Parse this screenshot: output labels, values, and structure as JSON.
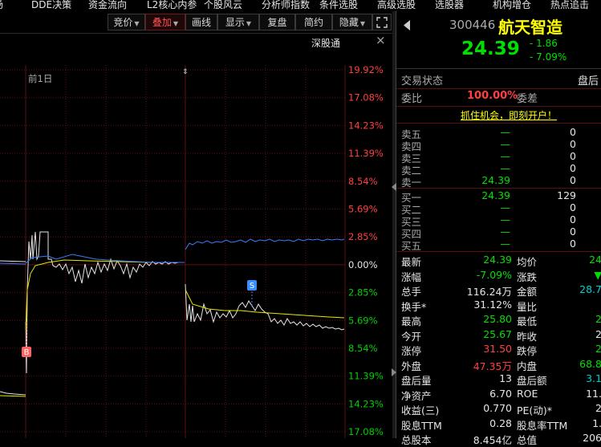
{
  "menu": [
    "场",
    "DDE决策",
    "资金流向",
    "L2核心内参",
    "个股风云",
    "分析师指数",
    "条件选股",
    "高级选股",
    "选股器",
    "机构增仓",
    "热点追击"
  ],
  "toolbar": {
    "buttons": [
      "竞价",
      "叠加",
      "画线",
      "显示",
      "复盘",
      "简约",
      "隐藏"
    ],
    "expand_icon": "expand-icon"
  },
  "chart": {
    "close_label": "×",
    "market_label": "深股通",
    "day_label": "前1日",
    "buy_marker": "B",
    "sell_marker": "S",
    "pct_labels": [
      "19.92%",
      "17.08%",
      "14.23%",
      "11.39%",
      "8.54%",
      "5.69%",
      "2.85%",
      "0.00%",
      "2.85%",
      "5.69%",
      "8.54%",
      "11.39%",
      "14.23%",
      "17.08%"
    ],
    "colors": {
      "up": "#ff3c3c",
      "down": "#00d000",
      "flat": "#e6e6e6",
      "avg": "#e8e800",
      "blue": "#3a7cff"
    }
  },
  "quote": {
    "code": "300446",
    "name": "航天智造",
    "price": "24.39",
    "change": "- 1.86",
    "change_pct": "- 7.09%",
    "trade_status_label": "交易状态",
    "trade_status_value": "盘后",
    "wei_bi_label": "委比",
    "wei_bi_value": "100.00%",
    "wei_cha_label": "委差",
    "promo": "抓住机会，即刻开户！"
  },
  "sell_book": [
    {
      "label": "卖五",
      "price": "—",
      "vol": "0"
    },
    {
      "label": "卖四",
      "price": "—",
      "vol": "0"
    },
    {
      "label": "卖三",
      "price": "—",
      "vol": "0"
    },
    {
      "label": "卖二",
      "price": "—",
      "vol": "0"
    },
    {
      "label": "卖一",
      "price": "24.39",
      "vol": "0"
    }
  ],
  "buy_book": [
    {
      "label": "买一",
      "price": "24.39",
      "vol": "129"
    },
    {
      "label": "买二",
      "price": "—",
      "vol": "0"
    },
    {
      "label": "买三",
      "price": "—",
      "vol": "0"
    },
    {
      "label": "买四",
      "price": "—",
      "vol": "0"
    },
    {
      "label": "买五",
      "price": "—",
      "vol": "0"
    }
  ],
  "stats": [
    {
      "l1": "最新",
      "v1": "24.39",
      "c1": "g",
      "l2": "均价",
      "v2": "24",
      "c2": "g"
    },
    {
      "l1": "涨幅",
      "v1": "-7.09%",
      "c1": "g",
      "l2": "涨跌",
      "v2": "▼",
      "c2": "g"
    },
    {
      "l1": "总手",
      "v1": "116.24万",
      "c1": "w",
      "l2": "金额",
      "v2": "28.7",
      "c2": "c"
    },
    {
      "l1": "换手*",
      "v1": "31.12%",
      "c1": "w",
      "l2": "量比",
      "v2": "",
      "c2": "w"
    },
    {
      "l1": "最高",
      "v1": "25.80",
      "c1": "g",
      "l2": "最低",
      "v2": "2",
      "c2": "g"
    },
    {
      "l1": "今开",
      "v1": "25.67",
      "c1": "g",
      "l2": "昨收",
      "v2": "2",
      "c2": "w"
    },
    {
      "l1": "涨停",
      "v1": "31.50",
      "c1": "r",
      "l2": "跌停",
      "v2": "2",
      "c2": "g"
    },
    {
      "l1": "外盘",
      "v1": "47.35万",
      "c1": "r",
      "l2": "内盘",
      "v2": "68.8",
      "c2": "g"
    },
    {
      "l1": "盘后量",
      "v1": "13",
      "c1": "w",
      "l2": "盘后额",
      "v2": "3.1",
      "c2": "c"
    },
    {
      "l1": "净资产",
      "v1": "6.70",
      "c1": "w",
      "l2": "ROE",
      "v2": "11.",
      "c2": "w"
    },
    {
      "l1": "收益(三)",
      "v1": "0.770",
      "c1": "w",
      "l2": "PE(动)*",
      "v2": "2",
      "c2": "w"
    },
    {
      "l1": "股息TTM",
      "v1": "0.28",
      "c1": "w",
      "l2": "股息率TTM",
      "v2": "1.",
      "c2": "w"
    },
    {
      "l1": "总股本",
      "v1": "8.454亿",
      "c1": "w",
      "l2": "总值",
      "v2": "206",
      "c2": "w"
    }
  ]
}
